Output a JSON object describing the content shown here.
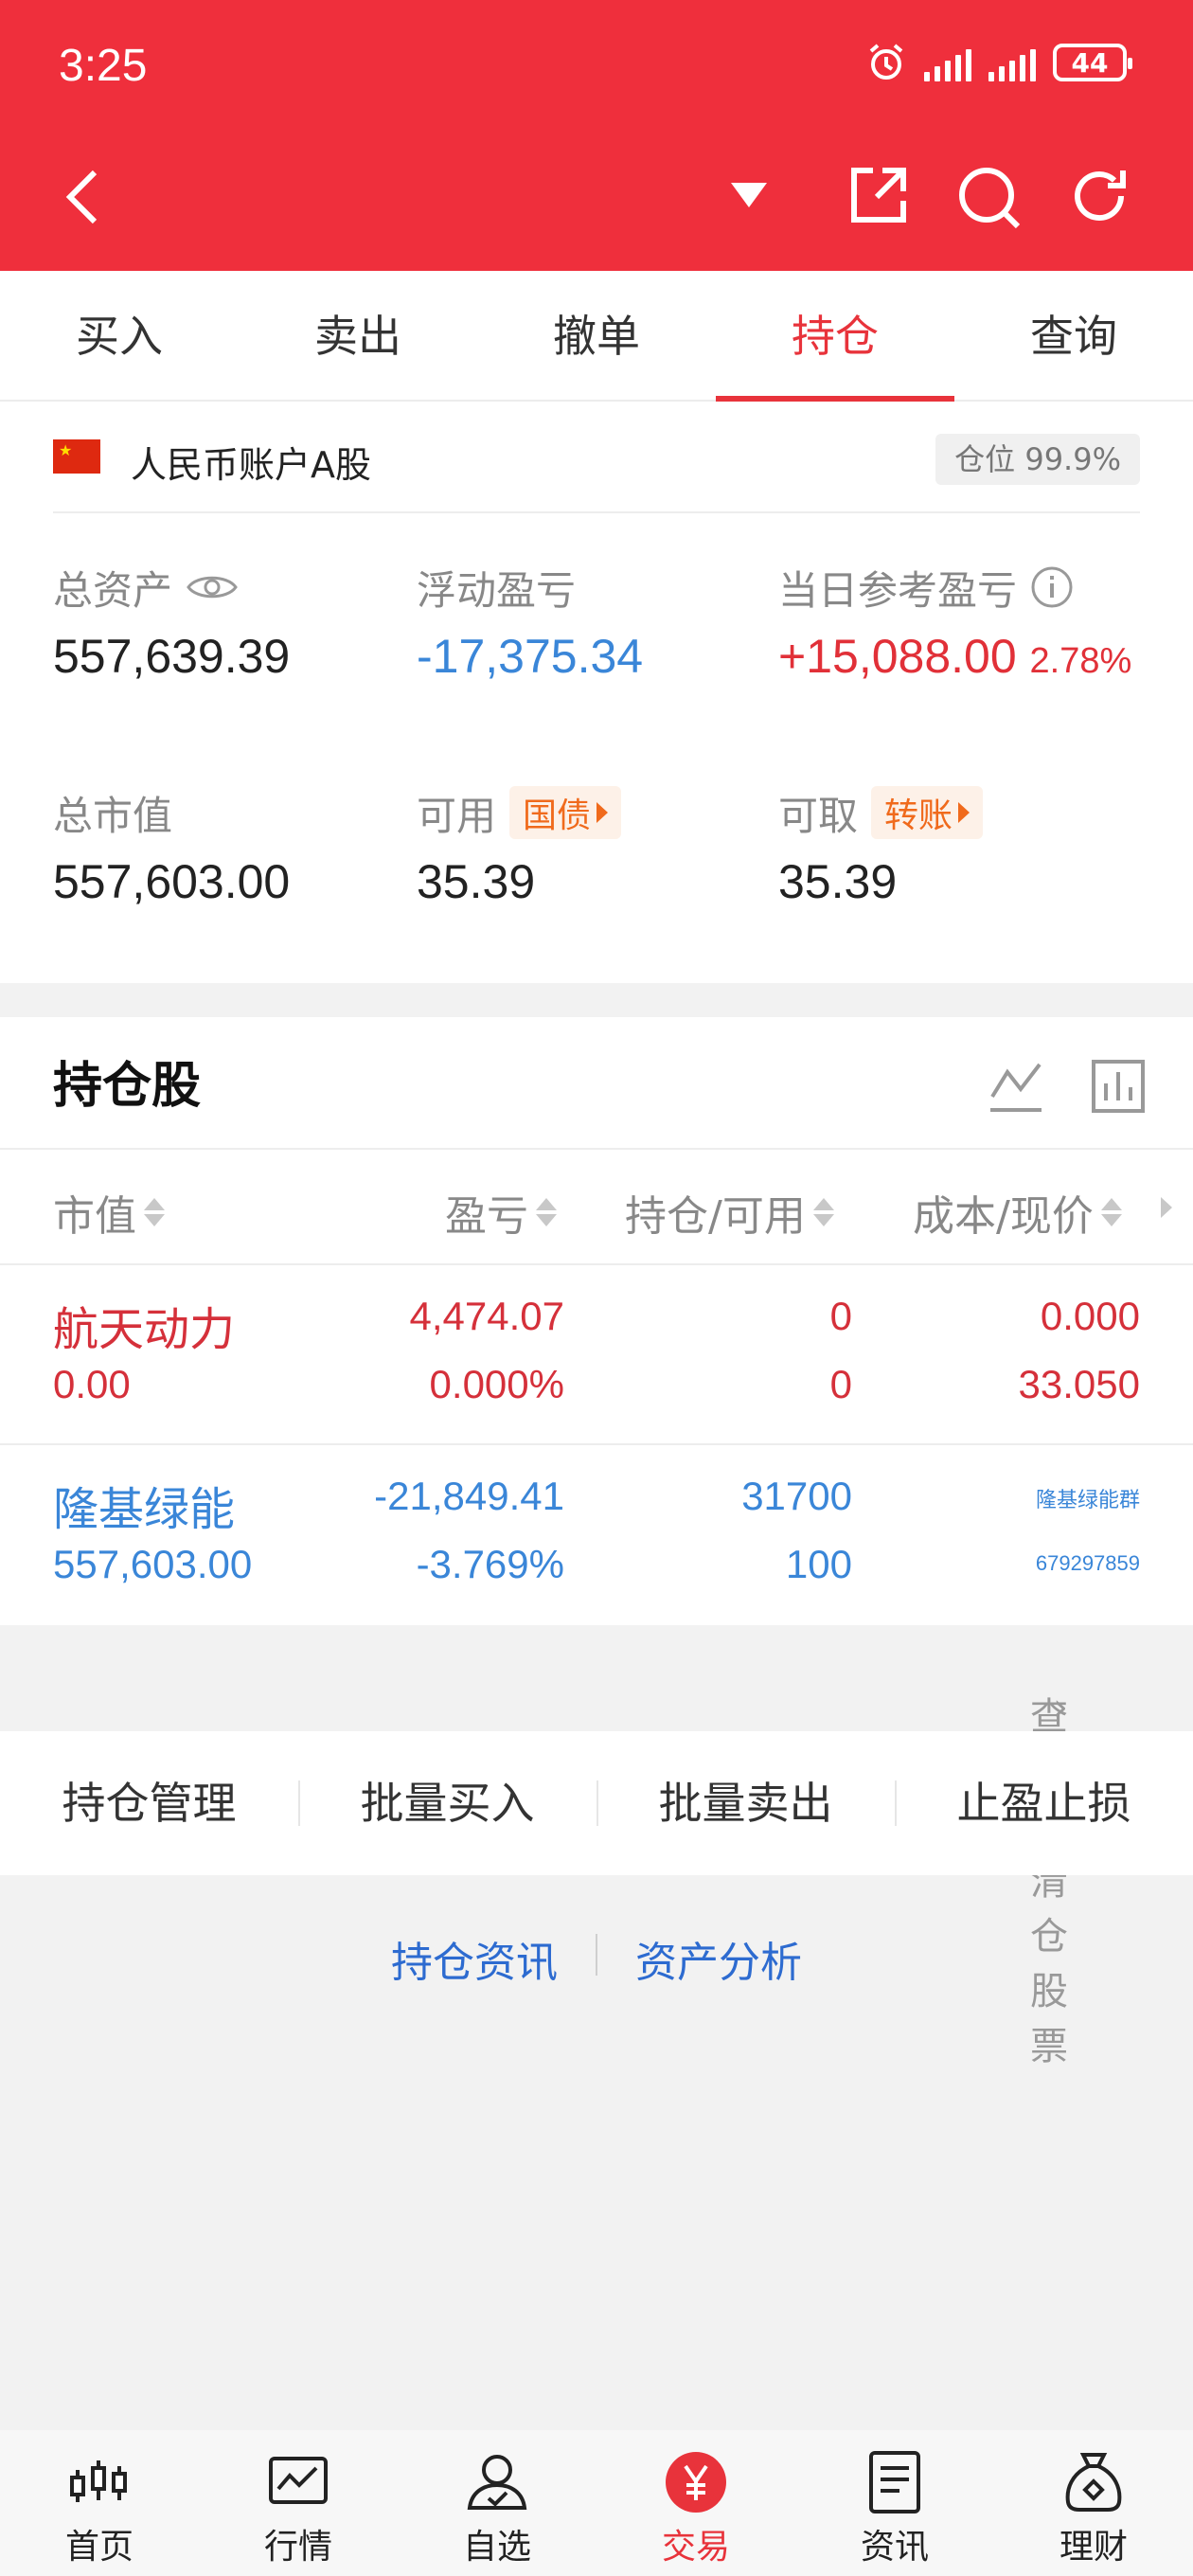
{
  "status": {
    "time": "3:25",
    "battery": "44"
  },
  "tabs": [
    "买入",
    "卖出",
    "撤单",
    "持仓",
    "查询"
  ],
  "active_tab": "持仓",
  "account": {
    "name": "人民币账户A股",
    "position_label": "仓位 99.9%",
    "total_assets_label": "总资产",
    "total_assets": "557,639.39",
    "floating_pl_label": "浮动盈亏",
    "floating_pl": "-17,375.34",
    "daily_pl_label": "当日参考盈亏",
    "daily_pl": "+15,088.00",
    "daily_pl_pct": "2.78%",
    "market_value_label": "总市值",
    "market_value": "557,603.00",
    "available_label": "可用",
    "available_tag": "国债",
    "available": "35.39",
    "withdrawable_label": "可取",
    "withdrawable_tag": "转账",
    "withdrawable": "35.39"
  },
  "holdings": {
    "title": "持仓股",
    "columns": [
      "市值",
      "盈亏",
      "持仓/可用",
      "成本/现价"
    ],
    "rows": [
      {
        "name": "航天动力",
        "market_value": "0.00",
        "pl": "4,474.07",
        "pl_pct": "0.000%",
        "position": "0",
        "available": "0",
        "cost": "0.000",
        "price": "33.050"
      },
      {
        "name": "隆基绿能",
        "market_value": "557,603.00",
        "pl": "-21,849.41",
        "pl_pct": "-3.769%",
        "position": "31700",
        "available": "100",
        "cost": "隆基绿能群",
        "price": "679297859"
      }
    ]
  },
  "cleared_link": "查看已清仓股票",
  "actions": [
    "持仓管理",
    "批量买入",
    "批量卖出",
    "止盈止损"
  ],
  "links": [
    "持仓资讯",
    "资产分析"
  ],
  "bottom_nav": [
    {
      "label": "首页",
      "icon": "candlestick-icon"
    },
    {
      "label": "行情",
      "icon": "line-chart-icon"
    },
    {
      "label": "自选",
      "icon": "user-check-icon"
    },
    {
      "label": "交易",
      "icon": "yen-icon"
    },
    {
      "label": "资讯",
      "icon": "document-icon"
    },
    {
      "label": "理财",
      "icon": "money-bag-icon"
    }
  ],
  "colors": {
    "brand": "#ef2f3c",
    "up": "#d5303a",
    "down": "#3a86d8",
    "link": "#2d6bd0"
  }
}
